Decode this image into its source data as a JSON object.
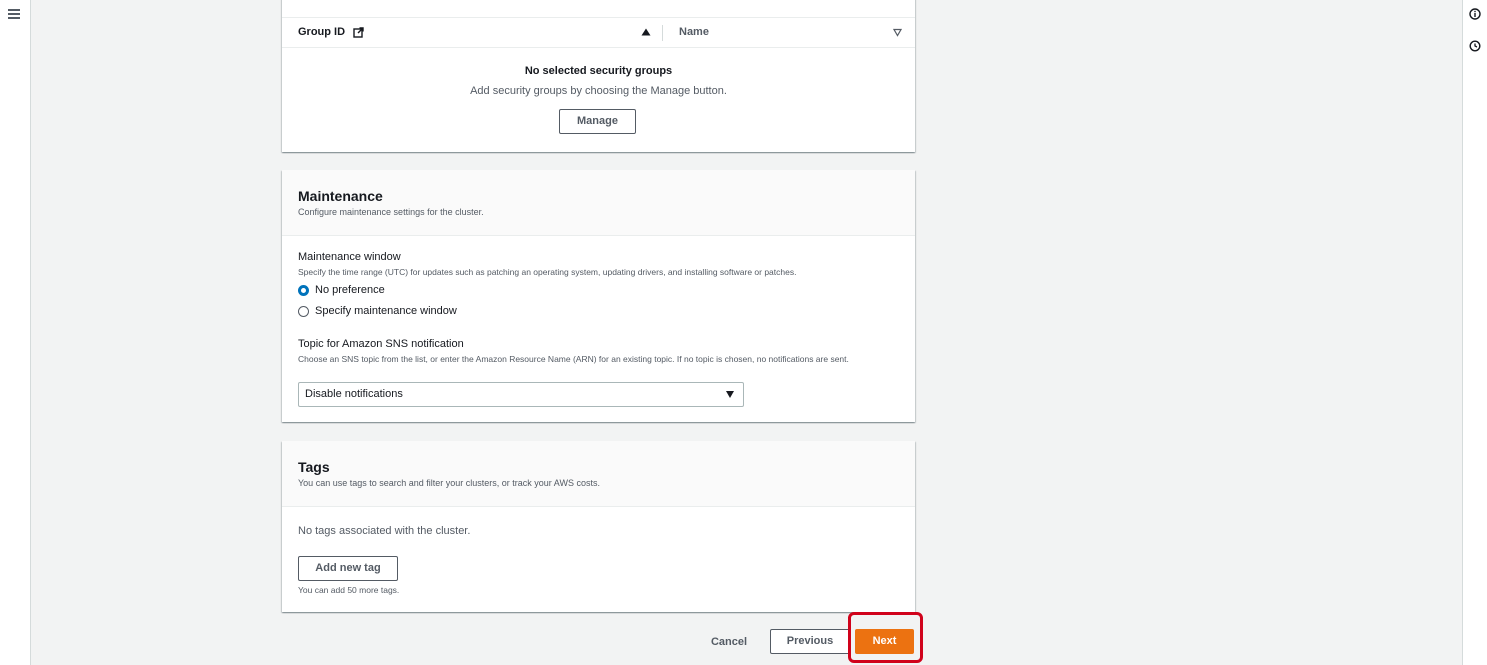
{
  "security_groups": {
    "columns": {
      "group_id": "Group ID",
      "name": "Name"
    },
    "empty_title": "No selected security groups",
    "empty_desc": "Add security groups by choosing the Manage button.",
    "manage_label": "Manage"
  },
  "maintenance": {
    "title": "Maintenance",
    "description": "Configure maintenance settings for the cluster.",
    "window_label": "Maintenance window",
    "window_desc": "Specify the time range (UTC) for updates such as patching an operating system, updating drivers, and installing software or patches.",
    "options": [
      {
        "label": "No preference",
        "checked": true
      },
      {
        "label": "Specify maintenance window",
        "checked": false
      }
    ],
    "sns_label": "Topic for Amazon SNS notification",
    "sns_desc": "Choose an SNS topic from the list, or enter the Amazon Resource Name (ARN) for an existing topic. If no topic is chosen, no notifications are sent.",
    "sns_value": "Disable notifications"
  },
  "tags": {
    "title": "Tags",
    "description": "You can use tags to search and filter your clusters, or track your AWS costs.",
    "empty": "No tags associated with the cluster.",
    "add_label": "Add new tag",
    "hint": "You can add 50 more tags."
  },
  "footer": {
    "cancel": "Cancel",
    "previous": "Previous",
    "next": "Next"
  },
  "colors": {
    "primary": "#ec7211",
    "highlight": "#d0021b",
    "radio_selected": "#0073bb"
  },
  "icons": {
    "menu": "hamburger-icon",
    "info": "info-icon",
    "history": "history-icon",
    "external": "external-link-icon"
  }
}
